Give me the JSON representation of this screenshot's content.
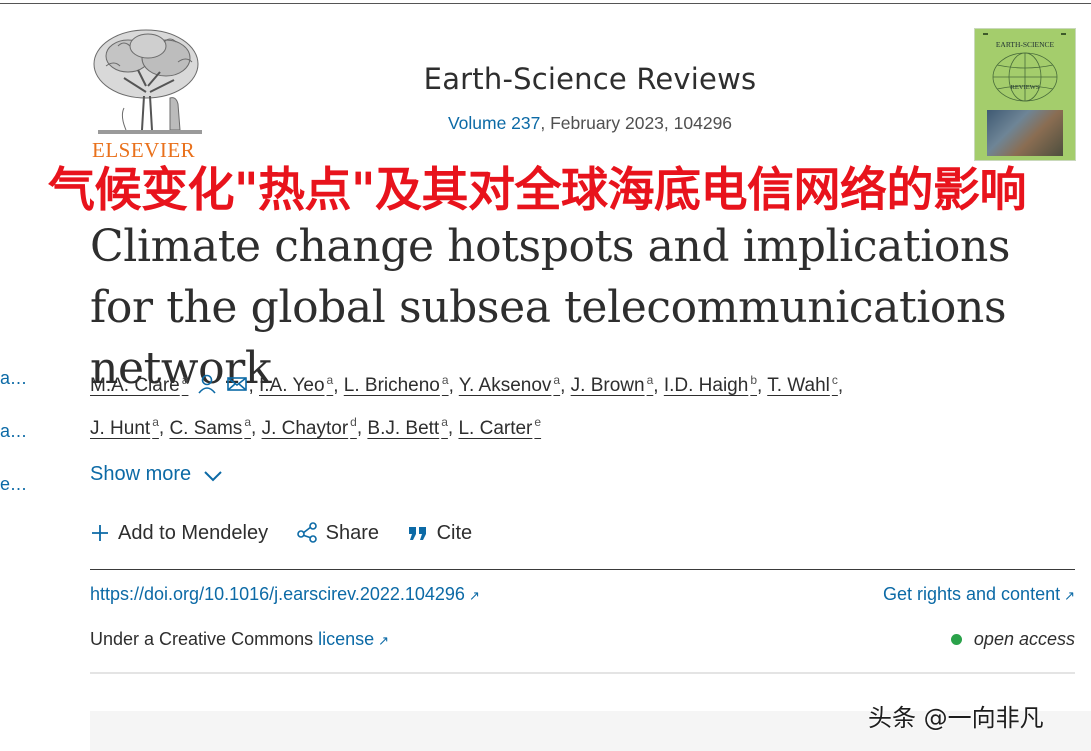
{
  "sidebar": {
    "items": [
      "a...",
      "a...",
      "e..."
    ]
  },
  "publisher": {
    "logo_text": "ELSEVIER"
  },
  "journal": {
    "title": "Earth-Science Reviews",
    "volume_link": "Volume 237",
    "issue_info": ", February 2023, 104296",
    "cover_title": "EARTH-SCIENCE",
    "cover_subtitle": "REVIEWS"
  },
  "overlay_title_cn": "气候变化\"热点\"及其对全球海底电信网络的影响",
  "article": {
    "title": "Climate change hotspots and implications for the global subsea telecommunications network"
  },
  "authors": [
    {
      "name": "M.A. Clare",
      "aff": "a"
    },
    {
      "name": "I.A. Yeo",
      "aff": "a"
    },
    {
      "name": "L. Bricheno",
      "aff": "a"
    },
    {
      "name": "Y. Aksenov",
      "aff": "a"
    },
    {
      "name": "J. Brown",
      "aff": "a"
    },
    {
      "name": "I.D. Haigh",
      "aff": "b"
    },
    {
      "name": "T. Wahl",
      "aff": "c"
    },
    {
      "name": "J. Hunt",
      "aff": "a"
    },
    {
      "name": "C. Sams",
      "aff": "a"
    },
    {
      "name": "J. Chaytor",
      "aff": "d"
    },
    {
      "name": "B.J. Bett",
      "aff": "a"
    },
    {
      "name": "L. Carter",
      "aff": "e"
    }
  ],
  "show_more_label": "Show more",
  "toolbar": {
    "mendeley": "Add to Mendeley",
    "share": "Share",
    "cite": "Cite"
  },
  "doi": "https://doi.org/10.1016/j.earscirev.2022.104296",
  "rights_link": "Get rights and content",
  "license": {
    "prefix": "Under a Creative Commons ",
    "link": "license"
  },
  "access": "open access",
  "watermark": "头条 @一向非凡",
  "colors": {
    "link": "#0c6aa6",
    "overlay": "#e8131c",
    "open_access": "#2aa24a",
    "elsevier": "#e9711c"
  }
}
